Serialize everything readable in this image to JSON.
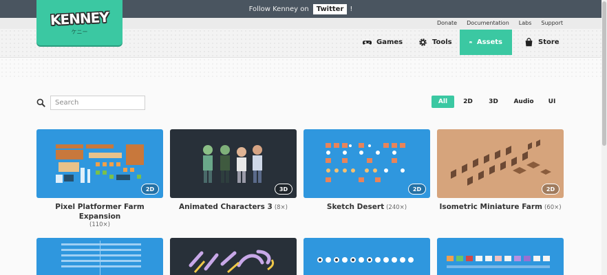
{
  "banner": {
    "text": "Follow Kenney on",
    "button": "Twitter",
    "suffix": "!"
  },
  "top_links": [
    "Donate",
    "Documentation",
    "Labs",
    "Support"
  ],
  "logo": {
    "word": "KENNEY",
    "kana": "ケニー"
  },
  "nav": [
    {
      "label": "Games",
      "icon": "gamepad-icon"
    },
    {
      "label": "Tools",
      "icon": "gear-icon"
    },
    {
      "label": "Assets",
      "icon": "image-icon",
      "active": true
    },
    {
      "label": "Store",
      "icon": "bag-icon"
    }
  ],
  "search": {
    "placeholder": "Search",
    "value": ""
  },
  "filters": [
    "All",
    "2D",
    "3D",
    "Audio",
    "UI"
  ],
  "active_filter": "All",
  "cards": [
    {
      "title": "Pixel Platformer Farm Expansion",
      "count": "(110×)",
      "badge": "2D",
      "color": "#2f97de"
    },
    {
      "title": "Animated Characters 3",
      "count": "(8×)",
      "badge": "3D",
      "color": "#283039"
    },
    {
      "title": "Sketch Desert",
      "count": "(240×)",
      "badge": "2D",
      "color": "#2f97de"
    },
    {
      "title": "Isometric Miniature Farm",
      "count": "(60×)",
      "badge": "2D",
      "color": "#d6a47c"
    }
  ],
  "accent_color": "#3bc8a2"
}
